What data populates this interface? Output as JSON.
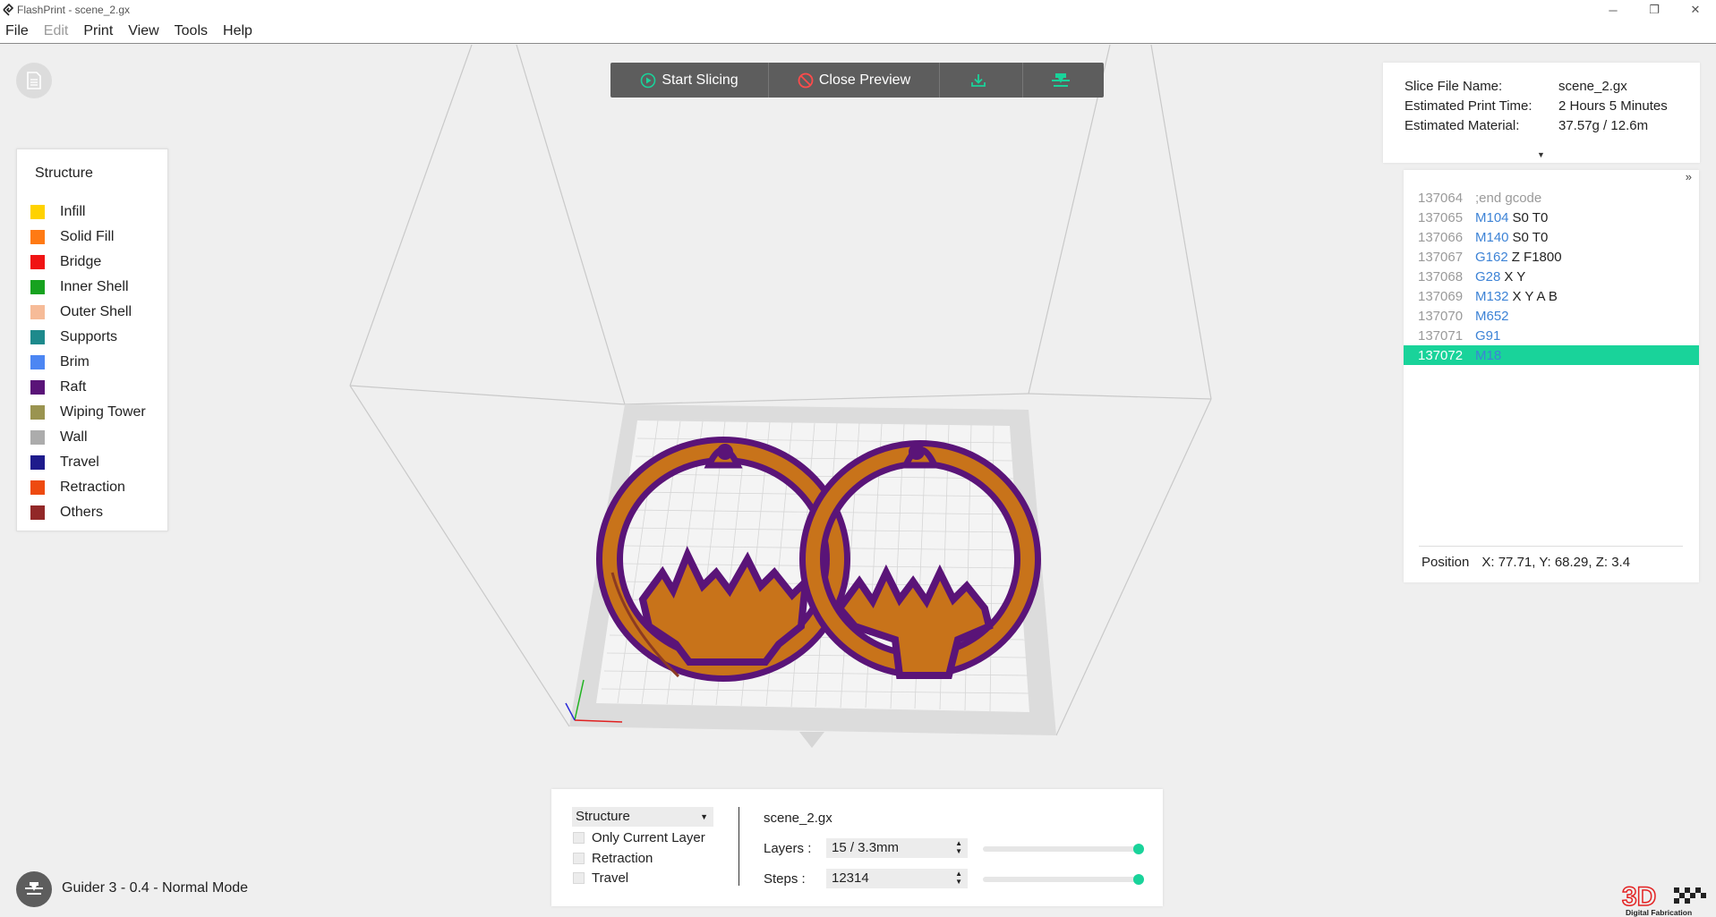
{
  "window": {
    "title": "FlashPrint - scene_2.gx",
    "controls": [
      "─",
      "❐",
      "✕"
    ]
  },
  "menu": [
    {
      "label": "File",
      "enabled": true
    },
    {
      "label": "Edit",
      "enabled": false
    },
    {
      "label": "Print",
      "enabled": true
    },
    {
      "label": "View",
      "enabled": true
    },
    {
      "label": "Tools",
      "enabled": true
    },
    {
      "label": "Help",
      "enabled": true
    }
  ],
  "toolbar": {
    "start_slicing": "Start Slicing",
    "close_preview": "Close Preview",
    "accent": "#19d39a"
  },
  "legend": {
    "title": "Structure",
    "items": [
      {
        "label": "Infill",
        "color": "#ffd200"
      },
      {
        "label": "Solid Fill",
        "color": "#ff7a14"
      },
      {
        "label": "Bridge",
        "color": "#f01414"
      },
      {
        "label": "Inner Shell",
        "color": "#17a21f"
      },
      {
        "label": "Outer Shell",
        "color": "#f6bb98"
      },
      {
        "label": "Supports",
        "color": "#1d8a8c"
      },
      {
        "label": "Brim",
        "color": "#4c86f3"
      },
      {
        "label": "Raft",
        "color": "#5a1478"
      },
      {
        "label": "Wiping Tower",
        "color": "#9a9450"
      },
      {
        "label": "Wall",
        "color": "#acacac"
      },
      {
        "label": "Travel",
        "color": "#1e1b8c"
      },
      {
        "label": "Retraction",
        "color": "#ee4a10"
      },
      {
        "label": "Others",
        "color": "#922828"
      }
    ]
  },
  "slice_info": {
    "rows": [
      {
        "label": "Slice File Name:",
        "value": "scene_2.gx"
      },
      {
        "label": "Estimated Print Time:",
        "value": "2 Hours 5 Minutes"
      },
      {
        "label": "Estimated Material:",
        "value": "37.57g / 12.6m"
      }
    ],
    "caret": "▼"
  },
  "gcode": {
    "expand": "»",
    "lines": [
      {
        "num": "137064",
        "cmd": "",
        "args": ";end gcode",
        "comment": true,
        "active": false
      },
      {
        "num": "137065",
        "cmd": "M104",
        "args": "S0 T0",
        "comment": false,
        "active": false
      },
      {
        "num": "137066",
        "cmd": "M140",
        "args": "S0 T0",
        "comment": false,
        "active": false
      },
      {
        "num": "137067",
        "cmd": "G162",
        "args": "Z F1800",
        "comment": false,
        "active": false
      },
      {
        "num": "137068",
        "cmd": "G28",
        "args": "X Y",
        "comment": false,
        "active": false
      },
      {
        "num": "137069",
        "cmd": "M132",
        "args": "X Y A B",
        "comment": false,
        "active": false
      },
      {
        "num": "137070",
        "cmd": "M652",
        "args": "",
        "comment": false,
        "active": false
      },
      {
        "num": "137071",
        "cmd": "G91",
        "args": "",
        "comment": false,
        "active": false
      },
      {
        "num": "137072",
        "cmd": "M18",
        "args": "",
        "comment": false,
        "active": true
      }
    ],
    "position_label": "Position",
    "position_value": "X: 77.71, Y: 68.29, Z: 3.4"
  },
  "controls": {
    "view_mode": "Structure",
    "checkboxes": [
      {
        "label": "Only Current Layer",
        "checked": false
      },
      {
        "label": "Retraction",
        "checked": false
      },
      {
        "label": "Travel",
        "checked": false
      }
    ],
    "file_name": "scene_2.gx",
    "layers_label": "Layers :",
    "layers_value": "15 / 3.3mm",
    "layers_fraction": 1.0,
    "steps_label": "Steps :",
    "steps_value": "12314",
    "steps_fraction": 1.0
  },
  "status": {
    "text": "Guider 3 - 0.4 - Normal Mode"
  },
  "brand": {
    "text": "3D",
    "subtitle": "Digital Fabrication"
  }
}
